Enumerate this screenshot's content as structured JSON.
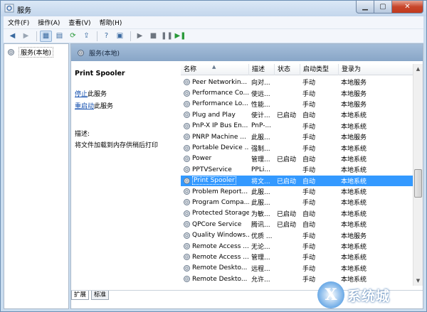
{
  "window": {
    "title": "服务"
  },
  "menu": [
    {
      "label": "文件(F)"
    },
    {
      "label": "操作(A)"
    },
    {
      "label": "查看(V)"
    },
    {
      "label": "帮助(H)"
    }
  ],
  "tree": {
    "root": "服务(本地)"
  },
  "main_header": "服务(本地)",
  "detail": {
    "service_name": "Print Spooler",
    "stop_link": "停止",
    "stop_suffix": "此服务",
    "restart_link": "重启动",
    "restart_suffix": "此服务",
    "desc_label": "描述:",
    "desc_text": "将文件加载到内存供稍后打印"
  },
  "columns": {
    "name": "名称",
    "desc": "描述",
    "status": "状态",
    "startup": "启动类型",
    "logon": "登录为"
  },
  "rows": [
    {
      "name": "Peer Networkin...",
      "desc": "向对...",
      "status": "",
      "startup": "手动",
      "logon": "本地服务"
    },
    {
      "name": "Performance Co...",
      "desc": "使远...",
      "status": "",
      "startup": "手动",
      "logon": "本地服务"
    },
    {
      "name": "Performance Lo...",
      "desc": "性能...",
      "status": "",
      "startup": "手动",
      "logon": "本地服务"
    },
    {
      "name": "Plug and Play",
      "desc": "使计...",
      "status": "已启动",
      "startup": "自动",
      "logon": "本地系统"
    },
    {
      "name": "PnP-X IP Bus En...",
      "desc": "PnP-...",
      "status": "",
      "startup": "手动",
      "logon": "本地系统"
    },
    {
      "name": "PNRP Machine ...",
      "desc": "此服...",
      "status": "",
      "startup": "手动",
      "logon": "本地服务"
    },
    {
      "name": "Portable Device ...",
      "desc": "强制...",
      "status": "",
      "startup": "手动",
      "logon": "本地系统"
    },
    {
      "name": "Power",
      "desc": "管理...",
      "status": "已启动",
      "startup": "自动",
      "logon": "本地系统"
    },
    {
      "name": "PPTVService",
      "desc": "PPLi...",
      "status": "",
      "startup": "手动",
      "logon": "本地系统"
    },
    {
      "name": "Print Spooler",
      "desc": "将文...",
      "status": "已启动",
      "startup": "自动",
      "logon": "本地系统"
    },
    {
      "name": "Problem Report...",
      "desc": "此服...",
      "status": "",
      "startup": "手动",
      "logon": "本地系统"
    },
    {
      "name": "Program Compa...",
      "desc": "此服...",
      "status": "",
      "startup": "手动",
      "logon": "本地系统"
    },
    {
      "name": "Protected Storage",
      "desc": "为敏...",
      "status": "已启动",
      "startup": "自动",
      "logon": "本地系统"
    },
    {
      "name": "QPCore Service",
      "desc": "腾讯...",
      "status": "已启动",
      "startup": "自动",
      "logon": "本地系统"
    },
    {
      "name": "Quality Windows...",
      "desc": "优质 ...",
      "status": "",
      "startup": "手动",
      "logon": "本地服务"
    },
    {
      "name": "Remote Access ...",
      "desc": "无论...",
      "status": "",
      "startup": "手动",
      "logon": "本地系统"
    },
    {
      "name": "Remote Access ...",
      "desc": "管理...",
      "status": "",
      "startup": "手动",
      "logon": "本地系统"
    },
    {
      "name": "Remote Deskto...",
      "desc": "远程...",
      "status": "",
      "startup": "手动",
      "logon": "本地系统"
    },
    {
      "name": "Remote Deskto...",
      "desc": "允许...",
      "status": "",
      "startup": "手动",
      "logon": "本地系统"
    }
  ],
  "selected_row": 9,
  "tabs": [
    {
      "label": "扩展"
    },
    {
      "label": "标准"
    }
  ],
  "watermark": {
    "glyph": "X",
    "text": "系统城"
  },
  "colors": {
    "selection": "#3399ff",
    "link": "#0f4cae",
    "header": "#88a6c7"
  }
}
